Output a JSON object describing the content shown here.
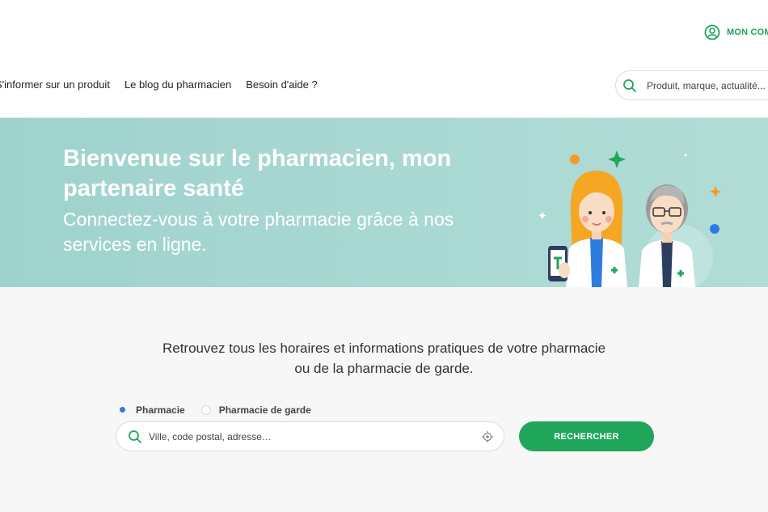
{
  "header": {
    "account_label": "MON COMPTE",
    "nav": [
      {
        "label": "S'informer sur un produit"
      },
      {
        "label": "Le blog du pharmacien"
      },
      {
        "label": "Besoin d'aide ?"
      }
    ],
    "search": {
      "placeholder": "Produit, marque, actualité..."
    }
  },
  "hero": {
    "title": "Bienvenue sur le pharmacien, mon partenaire santé",
    "subtitle": "Connectez-vous à votre pharmacie grâce à nos services en ligne."
  },
  "locator": {
    "intro": "Retrouvez tous les horaires et informations pratiques de votre pharmacie ou de la pharmacie de garde.",
    "options": [
      {
        "label": "Pharmacie",
        "selected": true
      },
      {
        "label": "Pharmacie de garde",
        "selected": false
      }
    ],
    "input_placeholder": "Ville, code postal, adresse…",
    "button_label": "RECHERCHER"
  },
  "colors": {
    "accent_green": "#1fa65a",
    "hero_background": "#a9d8d3",
    "radio_selected": "#2d7de0"
  },
  "icons": [
    "user-circle-icon",
    "search-icon",
    "location-target-icon"
  ]
}
